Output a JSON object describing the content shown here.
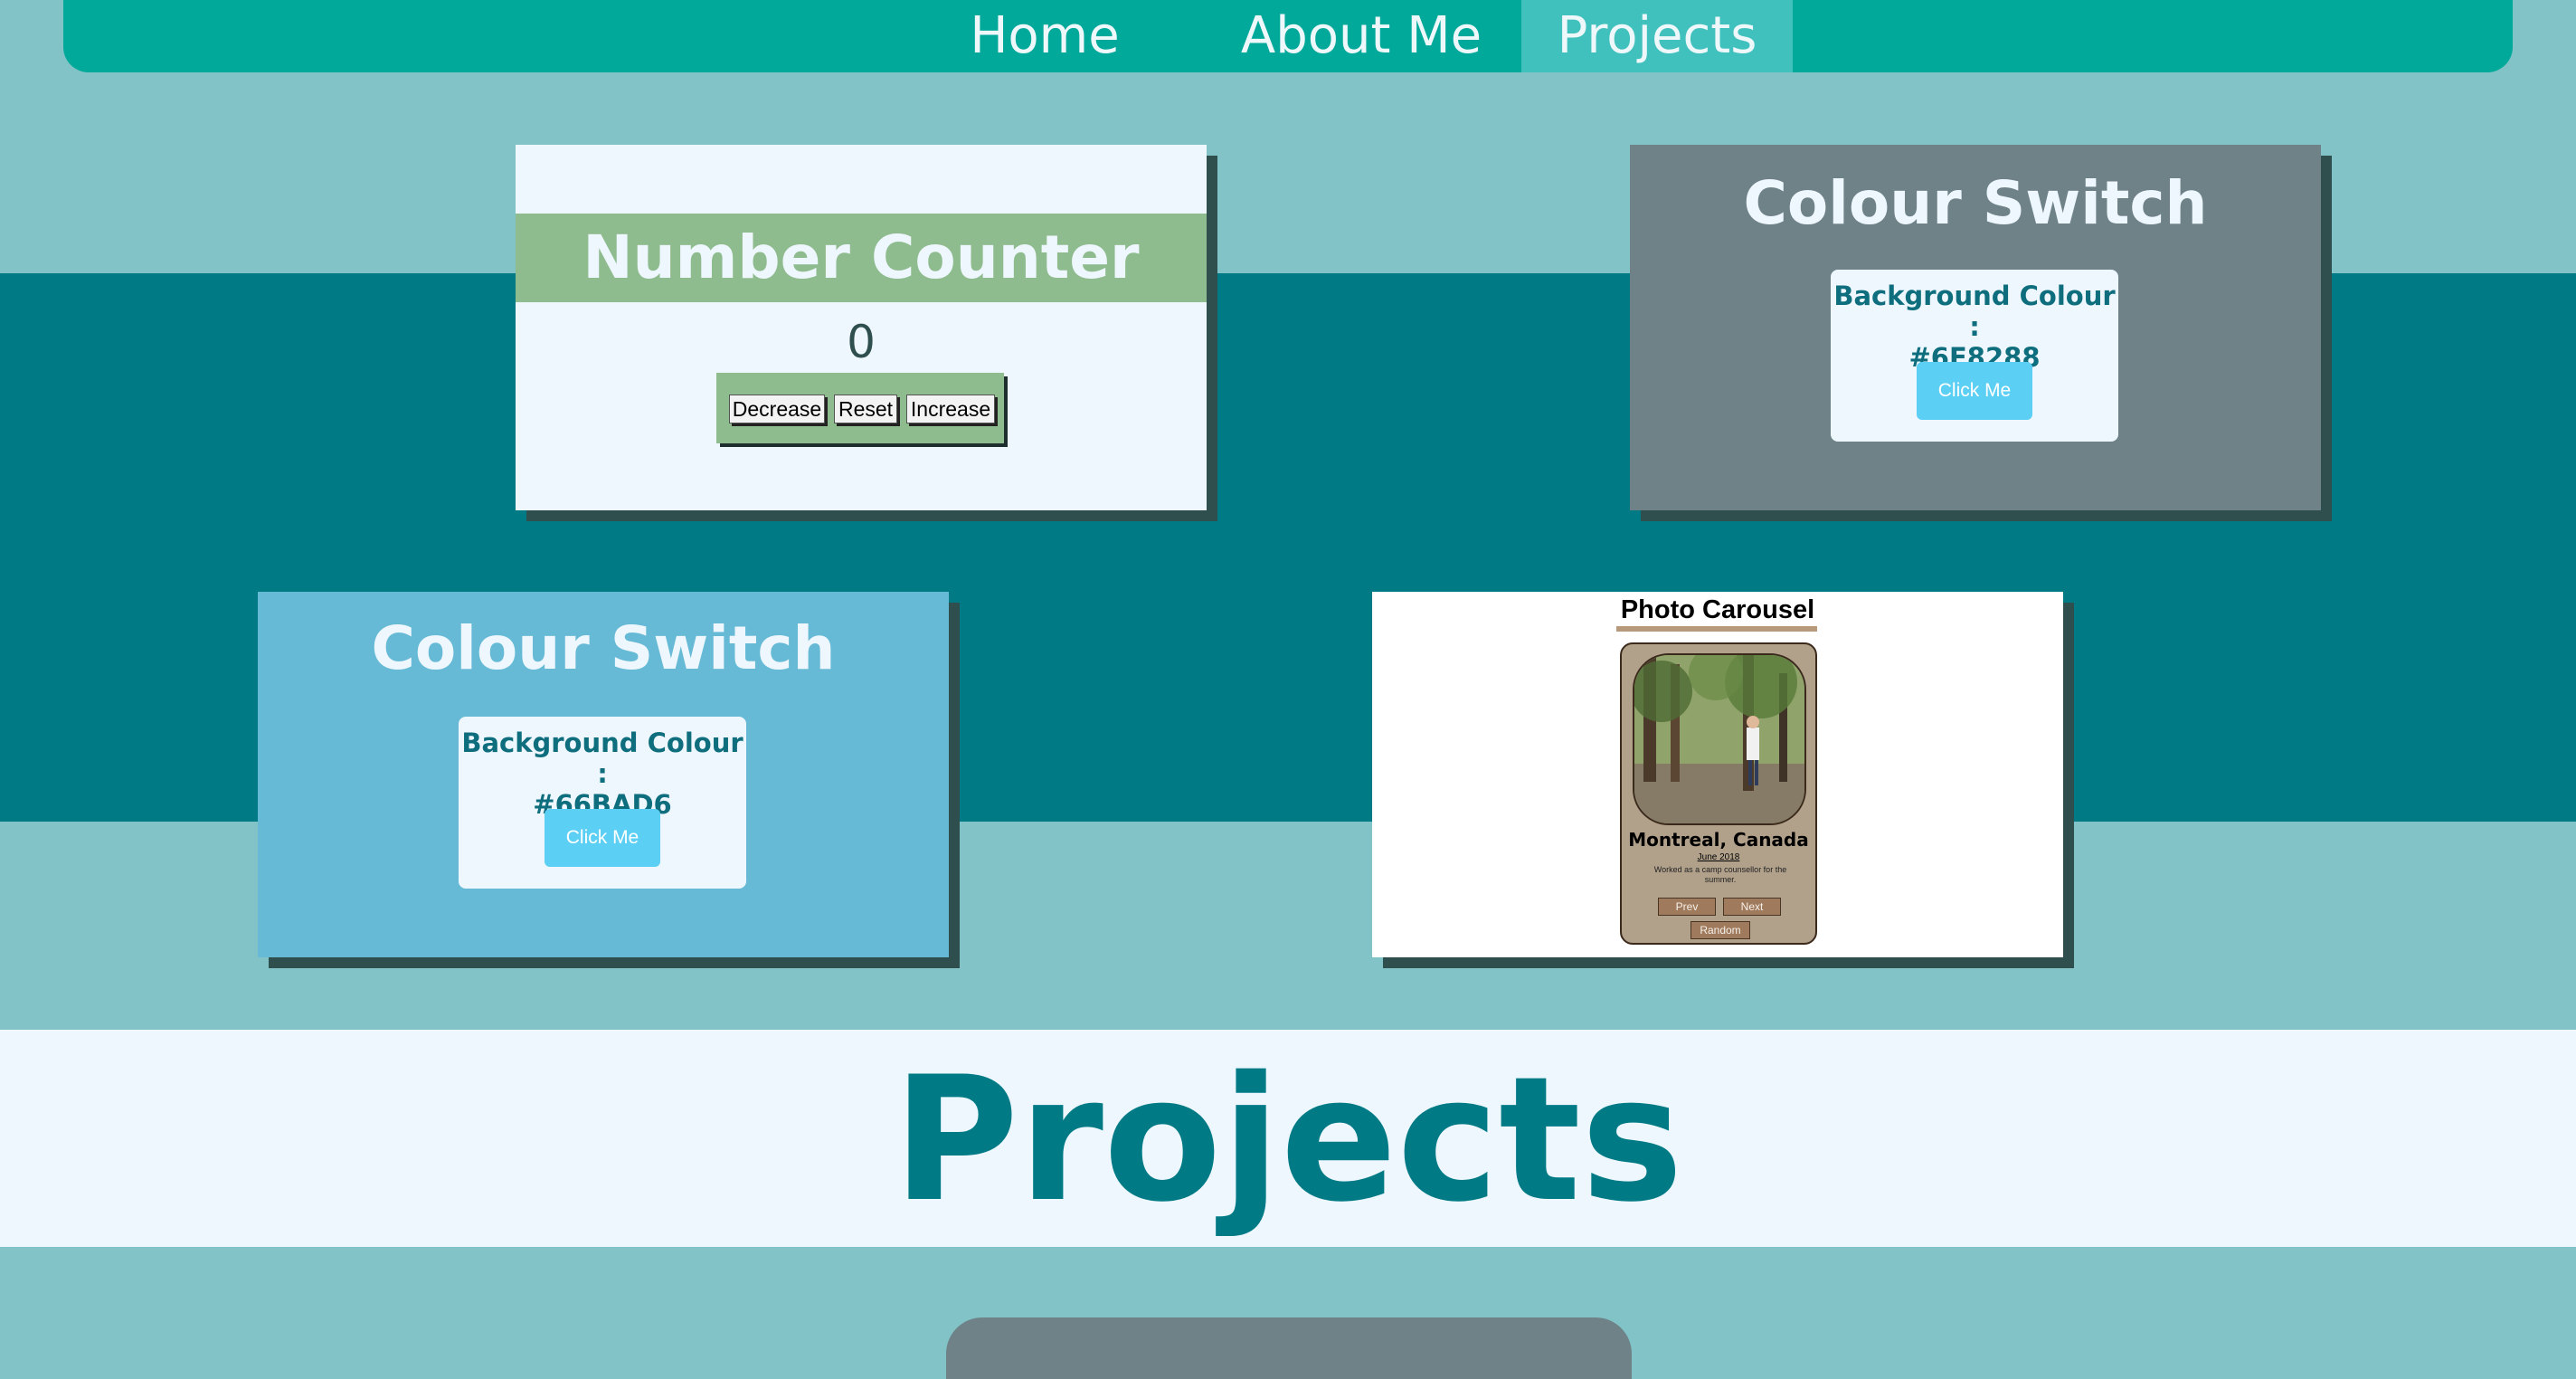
{
  "nav": {
    "items": [
      {
        "label": "Home"
      },
      {
        "label": "About Me"
      },
      {
        "label": "Projects"
      }
    ],
    "active": "Projects"
  },
  "counter": {
    "title": "Number Counter",
    "value": "0",
    "buttons": {
      "decrease": "Decrease",
      "reset": "Reset",
      "increase": "Increase"
    }
  },
  "colour_switch_1": {
    "title": "Colour Switch",
    "label_line1": "Background Colour :",
    "label_line2": "#6F8288",
    "button": "Click Me",
    "background": "#6F8288"
  },
  "colour_switch_2": {
    "title": "Colour Switch",
    "label_line1": "Background Colour :",
    "label_line2": "#66BAD6",
    "button": "Click Me",
    "background": "#66BAD6"
  },
  "carousel": {
    "title": "Photo Carousel",
    "location": "Montreal, Canada",
    "date": "June 2018",
    "description": "Worked as a camp counsellor for the summer.",
    "buttons": {
      "prev": "Prev",
      "next": "Next",
      "random": "Random"
    }
  },
  "section": {
    "heading": "Projects"
  },
  "colors": {
    "page_bg": "#81C3C7",
    "dark_band": "#007B86",
    "nav_bg": "#00A99A",
    "counter_accent": "#8FBC8F"
  }
}
